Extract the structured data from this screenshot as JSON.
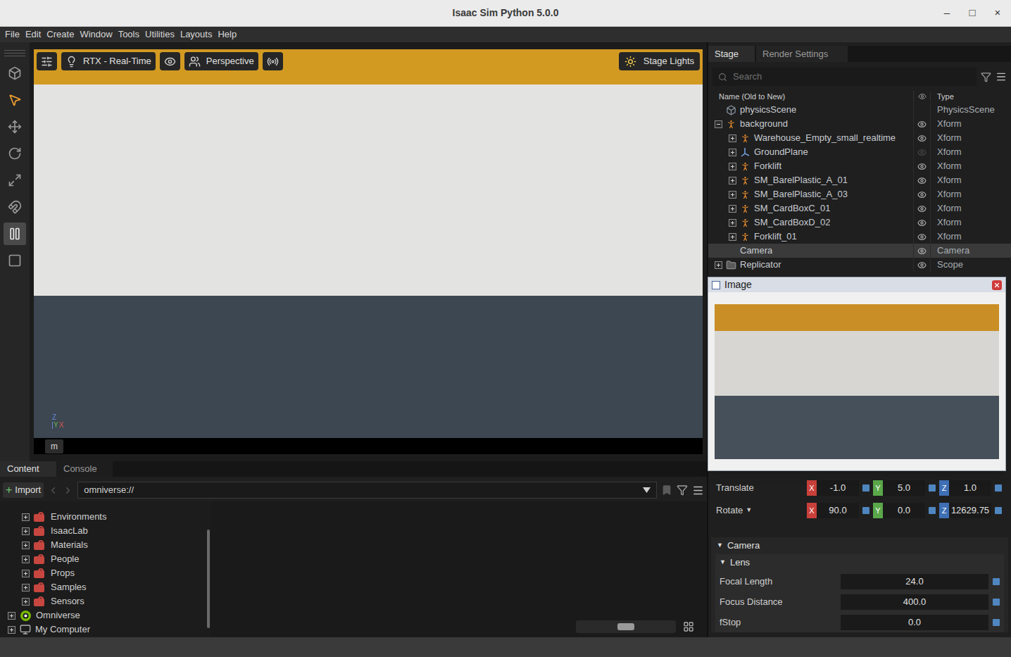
{
  "window": {
    "title": "Isaac Sim Python 5.0.0",
    "controls": [
      "–",
      "□",
      "×"
    ]
  },
  "menu": [
    "File",
    "Edit",
    "Create",
    "Window",
    "Tools",
    "Utilities",
    "Layouts",
    "Help"
  ],
  "tools": [
    {
      "selected": false,
      "pressed": false
    },
    {
      "selected": true,
      "pressed": false
    },
    {
      "selected": false,
      "pressed": false
    },
    {
      "selected": false,
      "pressed": false
    },
    {
      "selected": false,
      "pressed": false
    },
    {
      "selected": false,
      "pressed": false
    },
    {
      "selected": false,
      "pressed": true
    },
    {
      "selected": false,
      "pressed": false
    }
  ],
  "viewport": {
    "toolbar": [
      {
        "kind": "icon"
      },
      {
        "kind": "labeled",
        "label": "RTX - Real-Time"
      },
      {
        "kind": "icon"
      },
      {
        "kind": "labeled",
        "label": "Perspective"
      },
      {
        "kind": "icon"
      }
    ],
    "lights": {
      "label": "Stage Lights"
    },
    "unit": "m",
    "axes": [
      {
        "label": "Z",
        "color": "#6b86d6"
      },
      {
        "label": "Y",
        "color": "#6ab04c"
      },
      {
        "label": "X",
        "color": "#d9534f"
      }
    ]
  },
  "stage": {
    "tabs": [
      {
        "label": "Stage",
        "selected": true
      },
      {
        "label": "Render Settings",
        "selected": false
      }
    ],
    "search": {
      "placeholder": "Search"
    },
    "columns": [
      "Name (Old to New)",
      "Type"
    ],
    "rows": [
      {
        "name": "physicsScene",
        "type": "PhysicsScene",
        "depth": 0,
        "expandable": false,
        "expanded": false,
        "visibility": "none",
        "selected": false,
        "kind": "physics"
      },
      {
        "name": "background",
        "type": "Xform",
        "depth": 0,
        "expandable": true,
        "expanded": true,
        "visibility": "on",
        "selected": false,
        "kind": "xform"
      },
      {
        "name": "Warehouse_Empty_small_realtime",
        "type": "Xform",
        "depth": 1,
        "expandable": true,
        "expanded": false,
        "visibility": "on",
        "selected": false,
        "kind": "xform"
      },
      {
        "name": "GroundPlane",
        "type": "Xform",
        "depth": 1,
        "expandable": true,
        "expanded": false,
        "visibility": "off",
        "selected": false,
        "kind": "ground"
      },
      {
        "name": "Forklift",
        "type": "Xform",
        "depth": 1,
        "expandable": true,
        "expanded": false,
        "visibility": "on",
        "selected": false,
        "kind": "xform"
      },
      {
        "name": "SM_BarelPlastic_A_01",
        "type": "Xform",
        "depth": 1,
        "expandable": true,
        "expanded": false,
        "visibility": "on",
        "selected": false,
        "kind": "xform"
      },
      {
        "name": "SM_BarelPlastic_A_03",
        "type": "Xform",
        "depth": 1,
        "expandable": true,
        "expanded": false,
        "visibility": "on",
        "selected": false,
        "kind": "xform"
      },
      {
        "name": "SM_CardBoxC_01",
        "type": "Xform",
        "depth": 1,
        "expandable": true,
        "expanded": false,
        "visibility": "on",
        "selected": false,
        "kind": "xform"
      },
      {
        "name": "SM_CardBoxD_02",
        "type": "Xform",
        "depth": 1,
        "expandable": true,
        "expanded": false,
        "visibility": "on",
        "selected": false,
        "kind": "xform"
      },
      {
        "name": "Forklift_01",
        "type": "Xform",
        "depth": 1,
        "expandable": true,
        "expanded": false,
        "visibility": "on",
        "selected": false,
        "kind": "xform"
      },
      {
        "name": "Camera",
        "type": "Camera",
        "depth": 0,
        "expandable": false,
        "expanded": false,
        "visibility": "on",
        "selected": true,
        "kind": "camera"
      },
      {
        "name": "Replicator",
        "type": "Scope",
        "depth": 0,
        "expandable": true,
        "expanded": false,
        "visibility": "on",
        "selected": false,
        "kind": "scope"
      }
    ]
  },
  "image_window": {
    "title": "Image"
  },
  "properties": {
    "transforms": [
      {
        "label": "Translate",
        "glyph": "",
        "values": [
          {
            "axis": "X",
            "value": "-1.0",
            "color": "#c9403a"
          },
          {
            "axis": "Y",
            "value": "5.0",
            "color": "#5aa84a"
          },
          {
            "axis": "Z",
            "value": "1.0",
            "color": "#3f6fb5"
          }
        ]
      },
      {
        "label": "Rotate",
        "glyph": "▼",
        "values": [
          {
            "axis": "X",
            "value": "90.0",
            "color": "#c9403a"
          },
          {
            "axis": "Y",
            "value": "0.0",
            "color": "#5aa84a"
          },
          {
            "axis": "Z",
            "value": "12629.75",
            "color": "#3f6fb5"
          }
        ]
      }
    ],
    "section": {
      "glyph": "▼",
      "label": "Camera",
      "expanded": true,
      "subsection": {
        "glyph": "▼",
        "label": "Lens",
        "expanded": true,
        "rows": [
          {
            "label": "Focal Length",
            "value": "24.0"
          },
          {
            "label": "Focus Distance",
            "value": "400.0"
          },
          {
            "label": "fStop",
            "value": "0.0"
          }
        ]
      }
    }
  },
  "content": {
    "tabs": [
      {
        "label": "Content",
        "selected": true
      },
      {
        "label": "Console",
        "selected": false
      }
    ],
    "import": {
      "glyph": "+",
      "label": "Import"
    },
    "path": "omniverse://",
    "tree": [
      {
        "label": "Environments",
        "depth": 1,
        "expandable": true,
        "expanded": false,
        "kind": "locked-folder"
      },
      {
        "label": "IsaacLab",
        "depth": 1,
        "expandable": true,
        "expanded": false,
        "kind": "locked-folder"
      },
      {
        "label": "Materials",
        "depth": 1,
        "expandable": true,
        "expanded": false,
        "kind": "locked-folder"
      },
      {
        "label": "People",
        "depth": 1,
        "expandable": true,
        "expanded": false,
        "kind": "locked-folder"
      },
      {
        "label": "Props",
        "depth": 1,
        "expandable": true,
        "expanded": false,
        "kind": "locked-folder"
      },
      {
        "label": "Samples",
        "depth": 1,
        "expandable": true,
        "expanded": false,
        "kind": "locked-folder"
      },
      {
        "label": "Sensors",
        "depth": 1,
        "expandable": true,
        "expanded": false,
        "kind": "locked-folder"
      },
      {
        "label": "Omniverse",
        "depth": 0,
        "expandable": true,
        "expanded": false,
        "kind": "omniverse"
      },
      {
        "label": "My Computer",
        "depth": 0,
        "expandable": true,
        "expanded": false,
        "kind": "computer"
      }
    ]
  }
}
